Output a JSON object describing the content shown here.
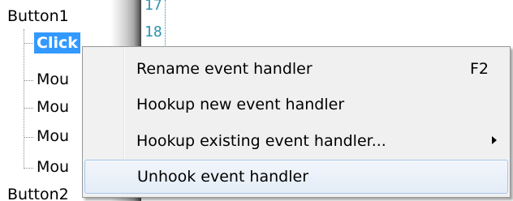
{
  "tree": {
    "root_label": "Button1",
    "selected_label": "Click",
    "children": [
      "Mou",
      "Mou",
      "Mou",
      "Mou"
    ],
    "next_root_label": "Button2"
  },
  "editor": {
    "line_numbers": [
      "17",
      "18"
    ]
  },
  "context_menu": {
    "items": [
      {
        "label": "Rename event handler",
        "shortcut": "F2"
      },
      {
        "label": "Hookup new event handler",
        "shortcut": ""
      },
      {
        "label": "Hookup existing event handler...",
        "shortcut": ""
      },
      {
        "label": "Unhook event handler",
        "shortcut": ""
      }
    ]
  },
  "colors": {
    "selection": "#3399ff",
    "line_number": "#2b91af",
    "menu_background": "#f0f0f0",
    "menu_hover_border": "#a8c8ec"
  }
}
